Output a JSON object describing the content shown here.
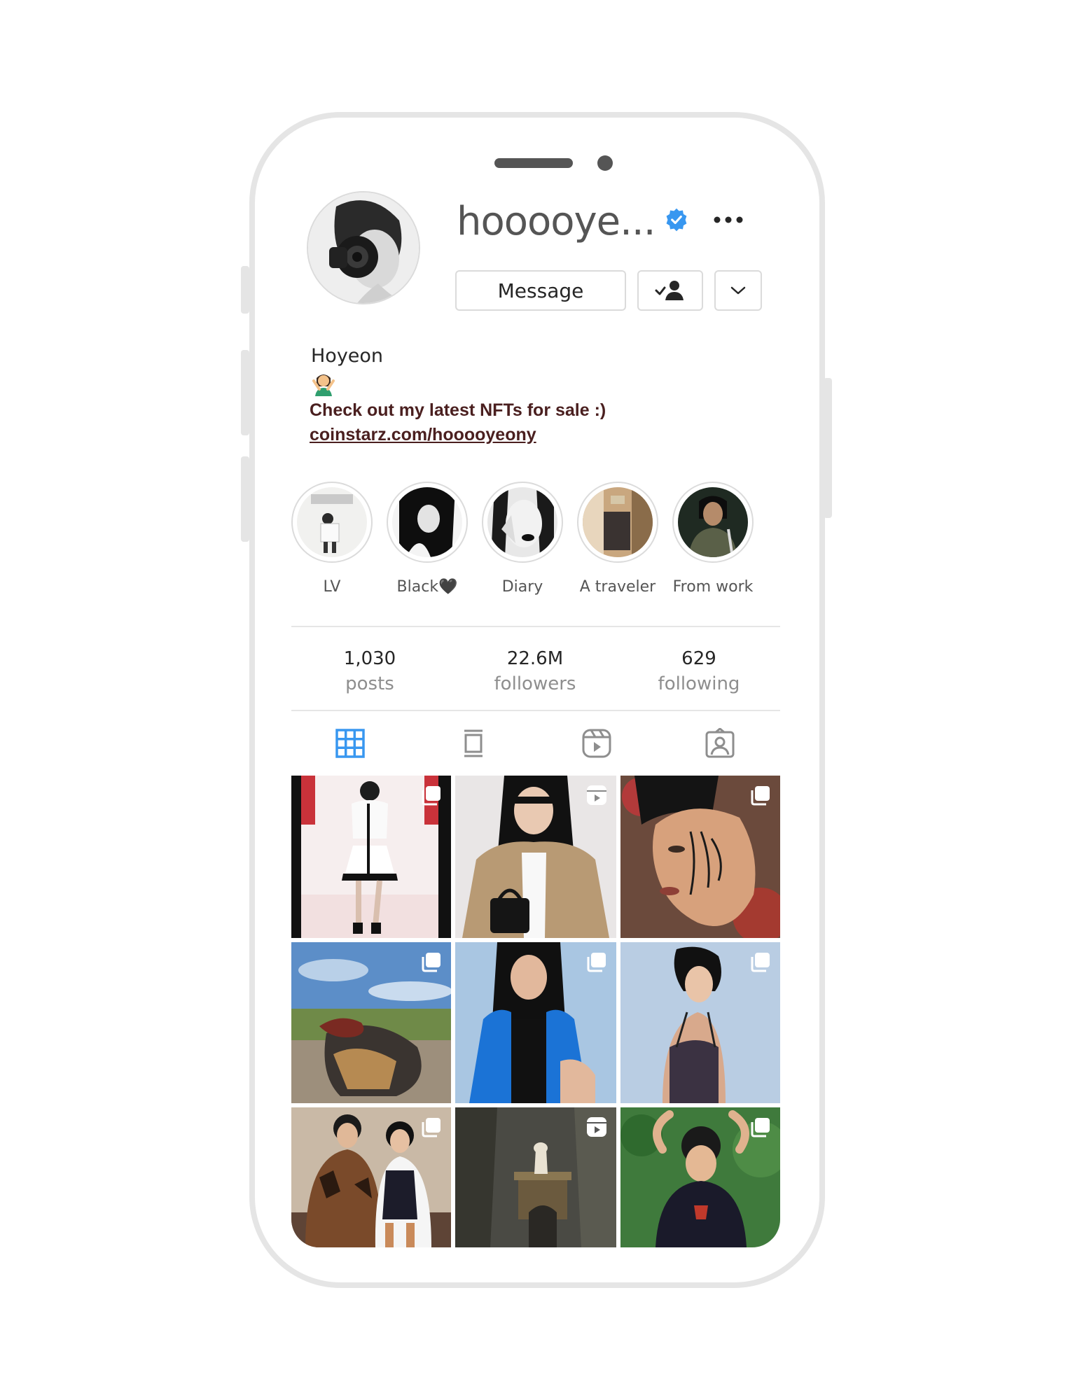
{
  "profile": {
    "username": "hooooye...",
    "display_name": "Hoyeon",
    "bio": "Check out my latest NFTs for sale :)",
    "link": "coinstarz.com/hooooyeony"
  },
  "actions": {
    "message_label": "Message"
  },
  "highlights": [
    {
      "label": "LV"
    },
    {
      "label": "Black🖤"
    },
    {
      "label": "Diary"
    },
    {
      "label": "A traveler"
    },
    {
      "label": "From work"
    }
  ],
  "stats": {
    "posts": {
      "count": "1,030",
      "label": "posts"
    },
    "followers": {
      "count": "22.6M",
      "label": "followers"
    },
    "following": {
      "count": "629",
      "label": "following"
    }
  },
  "tabs": [
    {
      "icon": "grid-icon",
      "active": true
    },
    {
      "icon": "feed-icon",
      "active": false
    },
    {
      "icon": "reels-icon",
      "active": false
    },
    {
      "icon": "tagged-icon",
      "active": false
    }
  ],
  "colors": {
    "accent": "#3897f0",
    "bio_text": "#4a1f1f",
    "border": "#dbdbdb"
  },
  "posts": [
    {
      "type": "carousel"
    },
    {
      "type": "reel"
    },
    {
      "type": "carousel"
    },
    {
      "type": "carousel"
    },
    {
      "type": "carousel"
    },
    {
      "type": "carousel"
    },
    {
      "type": "carousel"
    },
    {
      "type": "reel"
    },
    {
      "type": "carousel"
    }
  ]
}
